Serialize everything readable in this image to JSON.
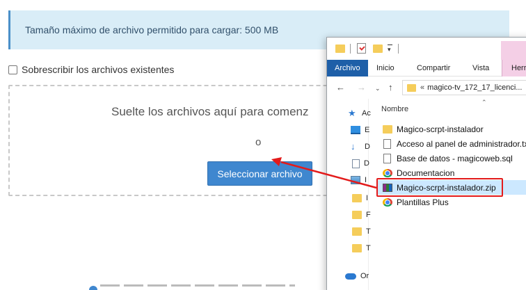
{
  "upload": {
    "max_size_notice": "Tamaño máximo de archivo permitido para cargar: 500 MB",
    "overwrite_label": "Sobrescribir los archivos existentes",
    "overwrite_checked": false,
    "drop_text": "Suelte los archivos aquí para comenz",
    "or_text": "o",
    "select_button": "Seleccionar archivo"
  },
  "explorer": {
    "ribbon_tabs": [
      {
        "label": "Archivo",
        "active": true
      },
      {
        "label": "Inicio",
        "active": false
      },
      {
        "label": "Compartir",
        "active": false
      },
      {
        "label": "Vista",
        "active": false
      },
      {
        "label": "Herr",
        "active": false
      }
    ],
    "address": "magico-tv_172_17_licenci...",
    "address_prefix": "«",
    "column_header": "Nombre",
    "nav_items": [
      {
        "icon": "star-icon",
        "label": "Ac"
      },
      {
        "icon": "desktop-icon",
        "label": "E"
      },
      {
        "icon": "download-icon",
        "label": "D"
      },
      {
        "icon": "document-icon",
        "label": "D"
      },
      {
        "icon": "image-icon",
        "label": "I"
      },
      {
        "icon": "folder-icon",
        "label": "I"
      },
      {
        "icon": "folder-icon",
        "label": "F"
      },
      {
        "icon": "folder-icon",
        "label": "T"
      },
      {
        "icon": "folder-icon",
        "label": "T"
      },
      {
        "icon": "onedrive-icon",
        "label": "Or"
      }
    ],
    "files": [
      {
        "icon": "folder-icon",
        "name": "Magico-scrpt-instalador",
        "selected": false
      },
      {
        "icon": "text-file-icon",
        "name": "Acceso al panel de administrador.txt",
        "selected": false
      },
      {
        "icon": "sql-file-icon",
        "name": "Base de datos - magicoweb.sql",
        "selected": false
      },
      {
        "icon": "chrome-icon",
        "name": "Documentacion",
        "selected": false
      },
      {
        "icon": "zip-archive-icon",
        "name": "Magico-scrpt-instalador.zip",
        "selected": true
      },
      {
        "icon": "chrome-icon",
        "name": "Plantillas Plus",
        "selected": false
      }
    ]
  },
  "colors": {
    "banner_bg": "#d9edf7",
    "button_bg": "#3f87cf",
    "ribbon_active": "#1e5fa8",
    "highlight": "#e31b1b",
    "selection": "#cce8ff"
  }
}
